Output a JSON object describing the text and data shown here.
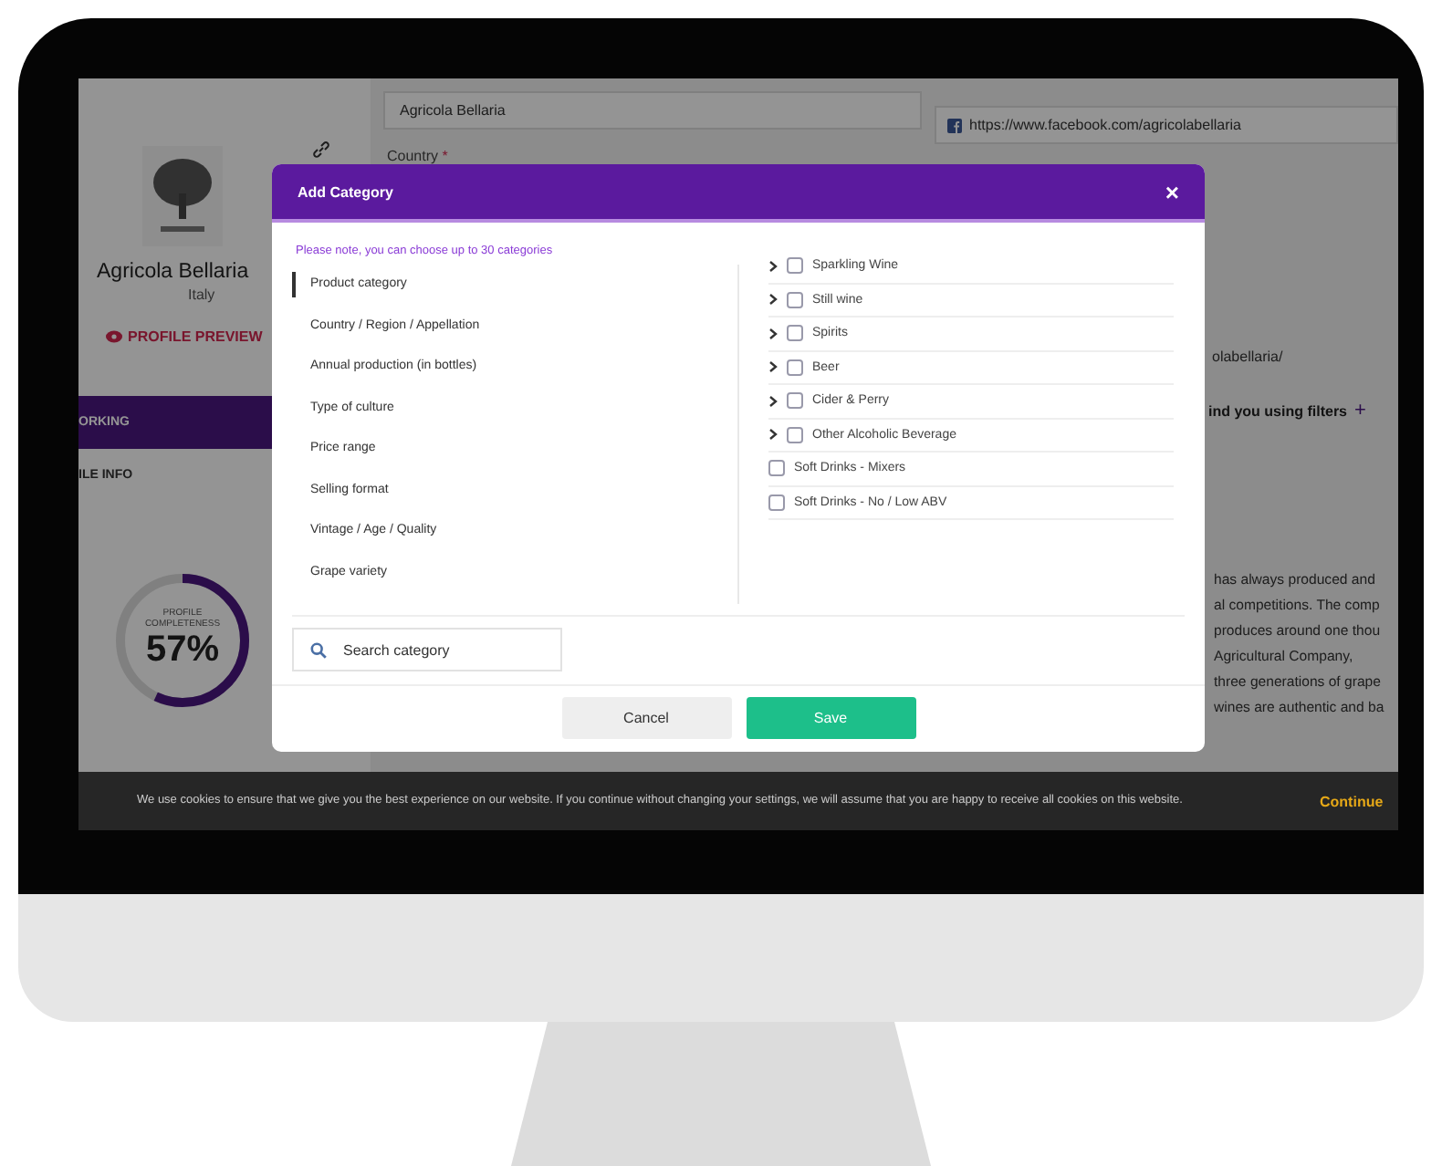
{
  "profile": {
    "name": "Agricola Bellaria",
    "country": "Italy",
    "preview_link": "PROFILE PREVIEW"
  },
  "nav": [
    {
      "label": "ORKING",
      "selected": true
    },
    {
      "label": "ILE INFO",
      "selected": false
    }
  ],
  "completeness": {
    "label": "PROFILE COMPLETENESS",
    "value": "57%",
    "level": 0.57
  },
  "form": {
    "company_value": "Agricola Bellaria",
    "country_label": "Country",
    "required_mark": "*"
  },
  "social": {
    "facebook_url": "https://www.facebook.com/agricolabellaria",
    "second_url": "olabellaria/"
  },
  "filters_text": "ind you using filters",
  "add_symbol": "+",
  "description_lines": [
    "has always produced and",
    "al competitions. The comp",
    "produces around one thou",
    "Agricultural Company,",
    "three generations of grape",
    "wines are authentic and ba"
  ],
  "modal": {
    "title": "Add Category",
    "close": "×",
    "note": "Please note, you can choose up to 30 categories",
    "categories": [
      {
        "label": "Product category",
        "selected": true
      },
      {
        "label": "Country / Region / Appellation",
        "selected": false
      },
      {
        "label": "Annual production (in bottles)",
        "selected": false
      },
      {
        "label": "Type of culture",
        "selected": false
      },
      {
        "label": "Price range",
        "selected": false
      },
      {
        "label": "Selling format",
        "selected": false
      },
      {
        "label": "Vintage / Age / Quality",
        "selected": false
      },
      {
        "label": "Grape variety",
        "selected": false
      }
    ],
    "options": [
      {
        "label": "Sparkling Wine",
        "kind": "group",
        "checked": false
      },
      {
        "label": "Still wine",
        "kind": "group",
        "checked": false
      },
      {
        "label": "Spirits",
        "kind": "group",
        "checked": false
      },
      {
        "label": "Beer",
        "kind": "group",
        "checked": false
      },
      {
        "label": "Cider & Perry",
        "kind": "group",
        "checked": false
      },
      {
        "label": "Other Alcoholic Beverage",
        "kind": "group",
        "checked": false
      },
      {
        "label": "Soft Drinks - Mixers",
        "kind": "item",
        "checked": false
      },
      {
        "label": "Soft Drinks - No / Low ABV",
        "kind": "item",
        "checked": false
      }
    ],
    "search_placeholder": "Search category",
    "cancel": "Cancel",
    "save": "Save"
  },
  "cookie_bar": {
    "text": "We use cookies to ensure that we give you the best experience on our website. If you continue without changing your settings, we will assume that you are happy to receive all cookies on this website.",
    "action": "Continue"
  }
}
